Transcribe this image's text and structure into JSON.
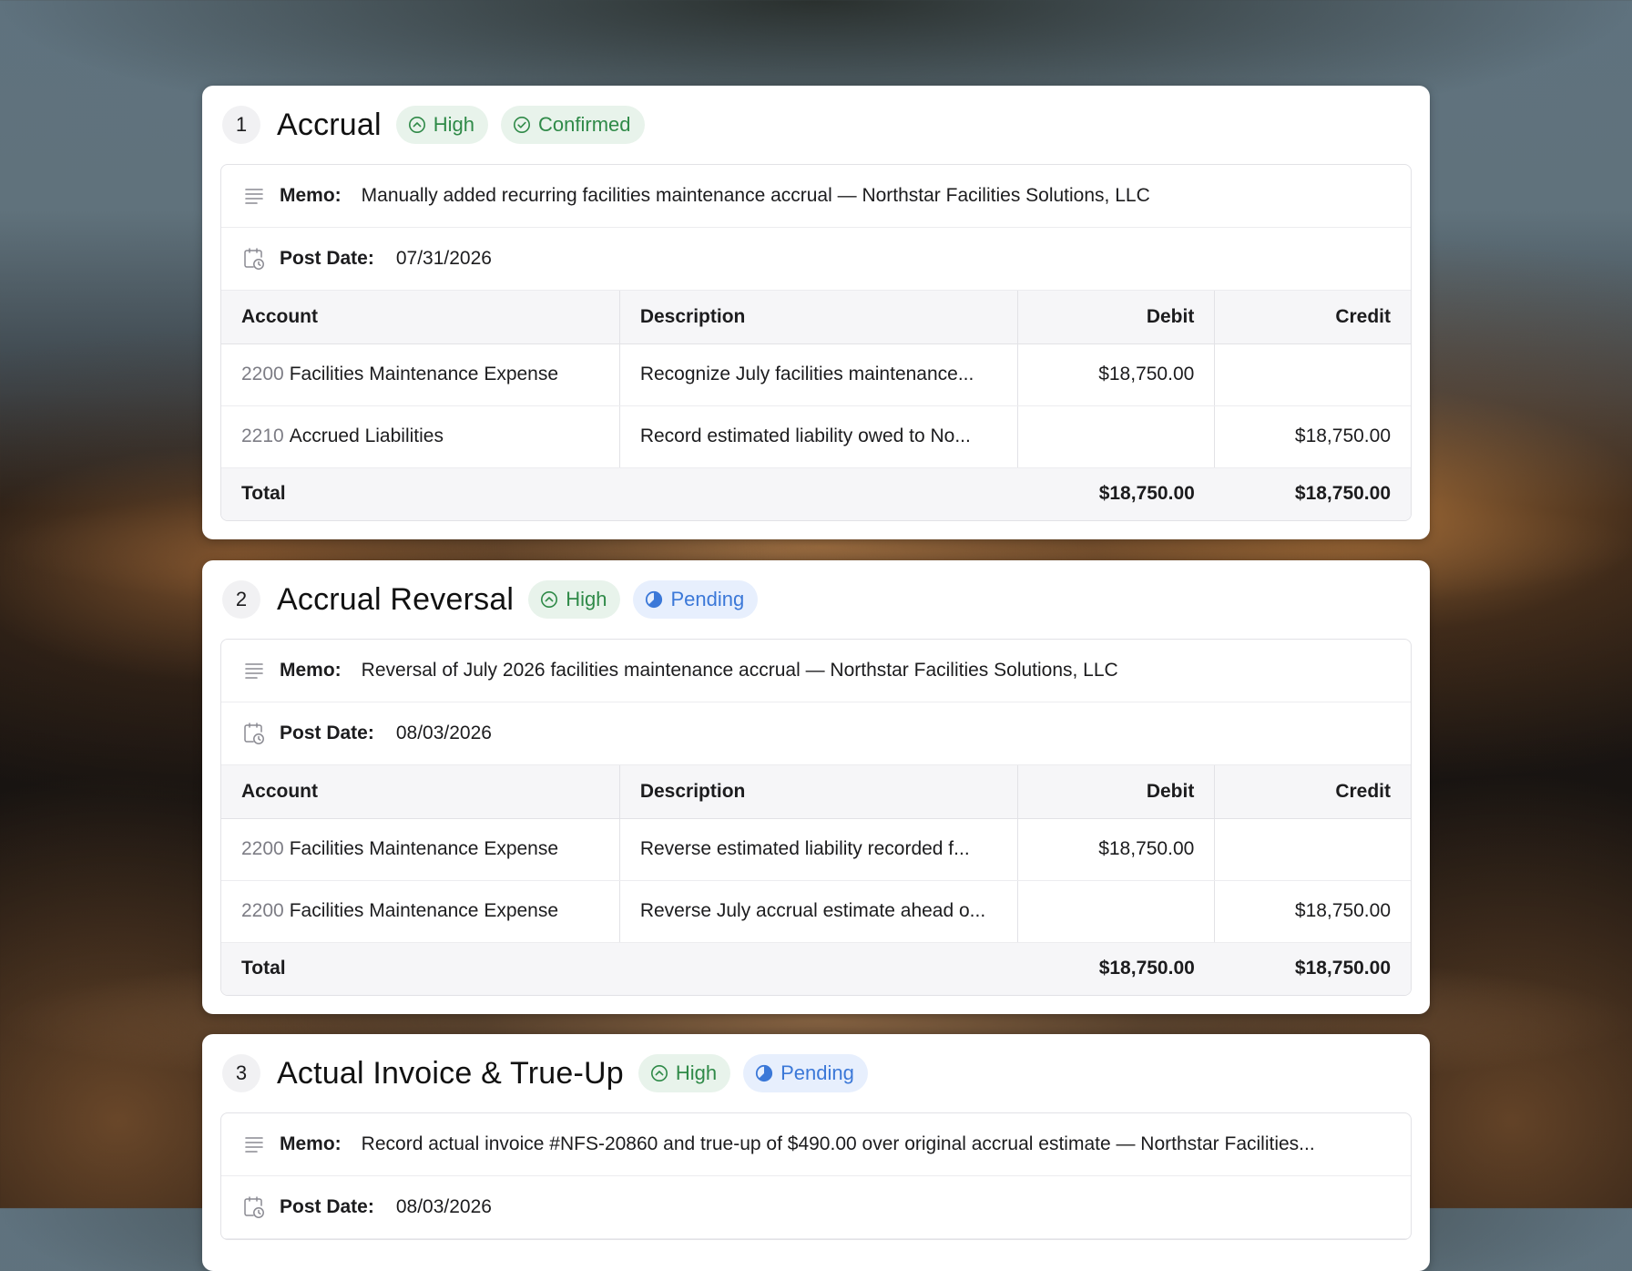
{
  "entries": [
    {
      "number": "1",
      "title": "Accrual",
      "priority": "High",
      "status": "Confirmed",
      "memo_label": "Memo:",
      "memo": "Manually added recurring facilities maintenance accrual — Northstar Facilities Solutions, LLC",
      "post_date_label": "Post Date:",
      "post_date": "07/31/2026",
      "columns": [
        "Account",
        "Description",
        "Debit",
        "Credit"
      ],
      "lines": [
        {
          "code": "2200",
          "account": "Facilities Maintenance Expense",
          "description": "Recognize July facilities maintenance...",
          "debit": "$18,750.00",
          "credit": ""
        },
        {
          "code": "2210",
          "account": "Accrued Liabilities",
          "description": "Record estimated liability owed to No...",
          "debit": "",
          "credit": "$18,750.00"
        }
      ],
      "total_label": "Total",
      "total_debit": "$18,750.00",
      "total_credit": "$18,750.00"
    },
    {
      "number": "2",
      "title": "Accrual Reversal",
      "priority": "High",
      "status": "Pending",
      "memo_label": "Memo:",
      "memo": "Reversal of July 2026 facilities maintenance accrual — Northstar Facilities Solutions, LLC",
      "post_date_label": "Post Date:",
      "post_date": "08/03/2026",
      "columns": [
        "Account",
        "Description",
        "Debit",
        "Credit"
      ],
      "lines": [
        {
          "code": "2200",
          "account": "Facilities Maintenance Expense",
          "description": "Reverse estimated liability recorded f...",
          "debit": "$18,750.00",
          "credit": ""
        },
        {
          "code": "2200",
          "account": "Facilities Maintenance Expense",
          "description": "Reverse July accrual estimate ahead o...",
          "debit": "",
          "credit": "$18,750.00"
        }
      ],
      "total_label": "Total",
      "total_debit": "$18,750.00",
      "total_credit": "$18,750.00"
    },
    {
      "number": "3",
      "title": "Actual Invoice & True-Up",
      "priority": "High",
      "status": "Pending",
      "memo_label": "Memo:",
      "memo": "Record actual invoice #NFS-20860 and true-up of $490.00 over original accrual estimate — Northstar Facilities...",
      "post_date_label": "Post Date:",
      "post_date": "08/03/2026"
    }
  ],
  "colors": {
    "priority_green": "#2f8a48",
    "priority_bg": "#e8f3eb",
    "pending_blue": "#3b78d8",
    "pending_bg": "#e7effd"
  },
  "icons": {
    "priority": "chevron-up-circle-icon",
    "confirmed": "check-circle-icon",
    "pending": "half-pie-icon",
    "memo": "lines-icon",
    "post_date": "calendar-clock-icon"
  }
}
